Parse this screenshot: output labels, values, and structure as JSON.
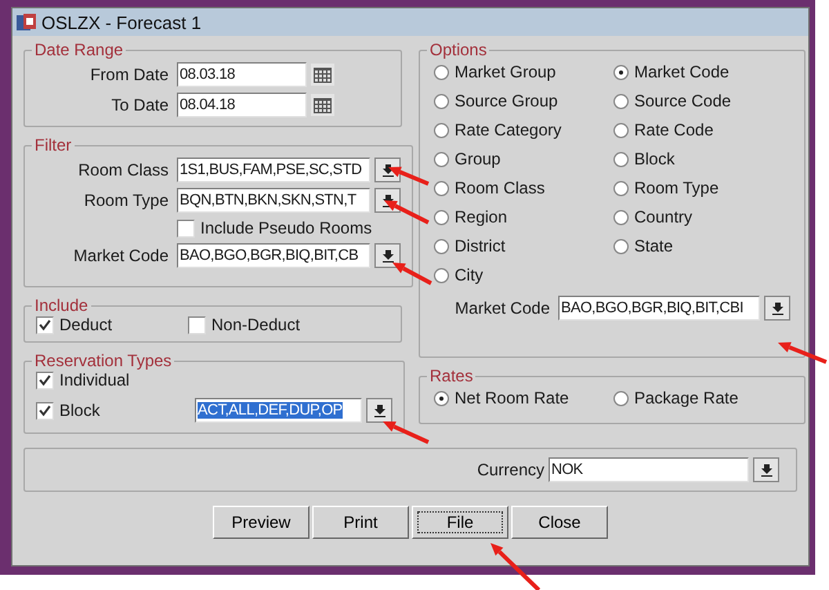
{
  "window": {
    "title": "OSLZX - Forecast 1"
  },
  "date_range": {
    "label": "Date Range",
    "fields": [
      {
        "label": "From Date",
        "value": "08.03.18"
      },
      {
        "label": "To Date",
        "value": "08.04.18"
      }
    ]
  },
  "filter": {
    "label": "Filter",
    "fields": [
      {
        "kind": "dropdown",
        "label": "Room Class",
        "value": "1S1,BUS,FAM,PSE,SC,STD"
      },
      {
        "kind": "dropdown",
        "label": "Room Type",
        "value": "BQN,BTN,BKN,SKN,STN,T"
      },
      {
        "kind": "checkbox",
        "label": "Include Pseudo Rooms",
        "checked": false
      },
      {
        "kind": "dropdown",
        "label": "Market Code",
        "value": "BAO,BGO,BGR,BIQ,BIT,CB"
      }
    ]
  },
  "include": {
    "label": "Include",
    "items": [
      {
        "label": "Deduct",
        "checked": true
      },
      {
        "label": "Non-Deduct",
        "checked": false
      }
    ]
  },
  "reservation_types": {
    "label": "Reservation Types",
    "items": [
      {
        "label": "Individual",
        "checked": true
      },
      {
        "label": "Block",
        "checked": true,
        "value": "ACT,ALL,DEF,DUP,OP",
        "highlighted": true
      }
    ]
  },
  "options": {
    "label": "Options",
    "radios": [
      {
        "label": "Market Group",
        "selected": false
      },
      {
        "label": "Market Code",
        "selected": true
      },
      {
        "label": "Source Group",
        "selected": false
      },
      {
        "label": "Source Code",
        "selected": false
      },
      {
        "label": "Rate Category",
        "selected": false
      },
      {
        "label": "Rate Code",
        "selected": false
      },
      {
        "label": "Group",
        "selected": false
      },
      {
        "label": "Block",
        "selected": false
      },
      {
        "label": "Room Class",
        "selected": false
      },
      {
        "label": "Room Type",
        "selected": false
      },
      {
        "label": "Region",
        "selected": false
      },
      {
        "label": "Country",
        "selected": false
      },
      {
        "label": "District",
        "selected": false
      },
      {
        "label": "State",
        "selected": false
      },
      {
        "label": "City",
        "selected": false
      }
    ],
    "field": {
      "label": "Market Code",
      "value": "BAO,BGO,BGR,BIQ,BIT,CBI"
    }
  },
  "rates": {
    "label": "Rates",
    "radios": [
      {
        "label": "Net Room Rate",
        "selected": true
      },
      {
        "label": "Package Rate",
        "selected": false
      }
    ]
  },
  "currency": {
    "label": "Currency",
    "value": "NOK"
  },
  "buttons": [
    {
      "label": "Preview",
      "focused": false
    },
    {
      "label": "Print",
      "focused": false
    },
    {
      "label": "File",
      "focused": true
    },
    {
      "label": "Close",
      "focused": false
    }
  ]
}
